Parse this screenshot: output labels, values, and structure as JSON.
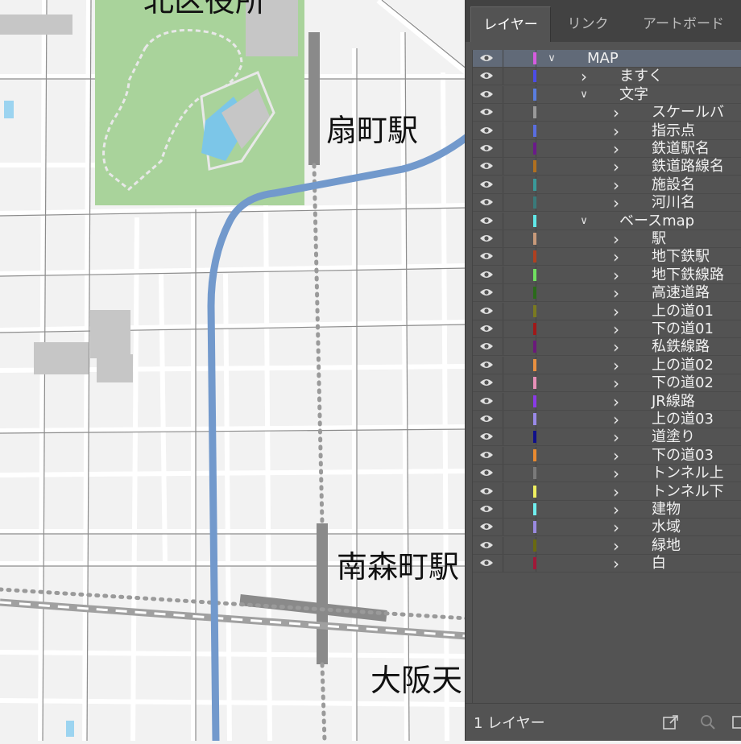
{
  "map": {
    "labels": {
      "top_partial": "北区役所",
      "ougimachi_station": "扇町駅",
      "minamimorimachi_station": "南森町駅",
      "osaka_tenmangu_partial": "大阪天"
    }
  },
  "panel": {
    "tabs": [
      {
        "label": "レイヤー",
        "active": true
      },
      {
        "label": "リンク",
        "active": false
      },
      {
        "label": "アートボード",
        "active": false
      }
    ],
    "layers": [
      {
        "name": "MAP",
        "color": "#d65ce0",
        "expanded": true,
        "selected": true
      },
      {
        "name": "ますく",
        "color": "#4c4ce8",
        "expanded": false
      },
      {
        "name": "文字",
        "color": "#5a7ee0",
        "expanded": true
      },
      {
        "name": "スケールバ",
        "color": "#9a9a9a",
        "expanded": false
      },
      {
        "name": "指示点",
        "color": "#5a6ee0",
        "expanded": false
      },
      {
        "name": "鉄道駅名",
        "color": "#6a1a8a",
        "expanded": false
      },
      {
        "name": "鉄道路線名",
        "color": "#b07020",
        "expanded": false
      },
      {
        "name": "施設名",
        "color": "#3a9a9a",
        "expanded": false
      },
      {
        "name": "河川名",
        "color": "#3a7a7a",
        "expanded": false
      },
      {
        "name": "ベースmap",
        "color": "#60e8e8",
        "expanded": true
      },
      {
        "name": "駅",
        "color": "#c89a7a",
        "expanded": false
      },
      {
        "name": "地下鉄駅",
        "color": "#b04020",
        "expanded": false
      },
      {
        "name": "地下鉄線路",
        "color": "#70e060",
        "expanded": false
      },
      {
        "name": "高速道路",
        "color": "#2a6a1a",
        "expanded": false
      },
      {
        "name": "上の道01",
        "color": "#7a7a20",
        "expanded": false
      },
      {
        "name": "下の道01",
        "color": "#a01818",
        "expanded": false
      },
      {
        "name": "私鉄線路",
        "color": "#6a1a7a",
        "expanded": false
      },
      {
        "name": "上の道02",
        "color": "#e89040",
        "expanded": false
      },
      {
        "name": "下の道02",
        "color": "#e890b8",
        "expanded": false
      },
      {
        "name": "JR線路",
        "color": "#8a3ae8",
        "expanded": false
      },
      {
        "name": "上の道03",
        "color": "#9a8ae8",
        "expanded": false
      },
      {
        "name": "道塗り",
        "color": "#10108a",
        "expanded": false
      },
      {
        "name": "下の道03",
        "color": "#e88a30",
        "expanded": false
      },
      {
        "name": "トンネル上",
        "color": "#7a7a7a",
        "expanded": false
      },
      {
        "name": "トンネル下",
        "color": "#f0f060",
        "expanded": false
      },
      {
        "name": "建物",
        "color": "#70f0f0",
        "expanded": false
      },
      {
        "name": "水域",
        "color": "#9a8ae0",
        "expanded": false
      },
      {
        "name": "緑地",
        "color": "#6a6a10",
        "expanded": false
      },
      {
        "name": "白",
        "color": "#a01838",
        "expanded": false
      }
    ],
    "footer": {
      "count_label": "1 レイヤー",
      "icons": [
        "export-icon",
        "search-icon",
        "new-layer-icon"
      ]
    }
  },
  "colors": {
    "panel_bg": "#535353",
    "tab_bg": "#424242",
    "selected_row": "#616a78",
    "map_bg": "#f2f2f2",
    "park": "#a9d39b",
    "subway_line": "#7299cc",
    "road_gray": "#8a8a8a"
  }
}
